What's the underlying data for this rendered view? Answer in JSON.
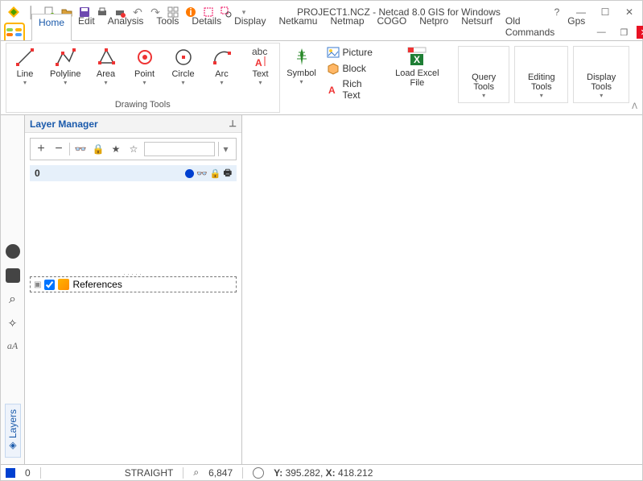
{
  "titlebar": {
    "title": "PROJECT1.NCZ - Netcad 8.0 GIS for Windows"
  },
  "tabs": {
    "items": [
      "Home",
      "Edit",
      "Analysis",
      "Tools",
      "Details",
      "Display",
      "Netkamu",
      "Netmap",
      "COGO",
      "Netpro",
      "Netsurf",
      "Old Commands",
      "Gps"
    ],
    "active": "Home"
  },
  "ribbon": {
    "drawing_group_label": "Drawing Tools",
    "line": "Line",
    "polyline": "Polyline",
    "area": "Area",
    "point": "Point",
    "circle": "Circle",
    "arc": "Arc",
    "text": "Text",
    "symbol": "Symbol",
    "picture": "Picture",
    "block": "Block",
    "richtext": "Rich Text",
    "loadexcel": "Load Excel File",
    "query_tools": "Query Tools",
    "editing_tools": "Editing Tools",
    "display_tools": "Display Tools"
  },
  "panel": {
    "title": "Layer Manager",
    "layer0": "0",
    "references": "References"
  },
  "sidebar": {
    "layers_tab": "Layers"
  },
  "status": {
    "count": "0",
    "mode": "STRAIGHT",
    "scale": "6,847",
    "coords_label_y": "Y:",
    "coords_y": "395.282,",
    "coords_label_x": "X:",
    "coords_x": "418.212"
  }
}
